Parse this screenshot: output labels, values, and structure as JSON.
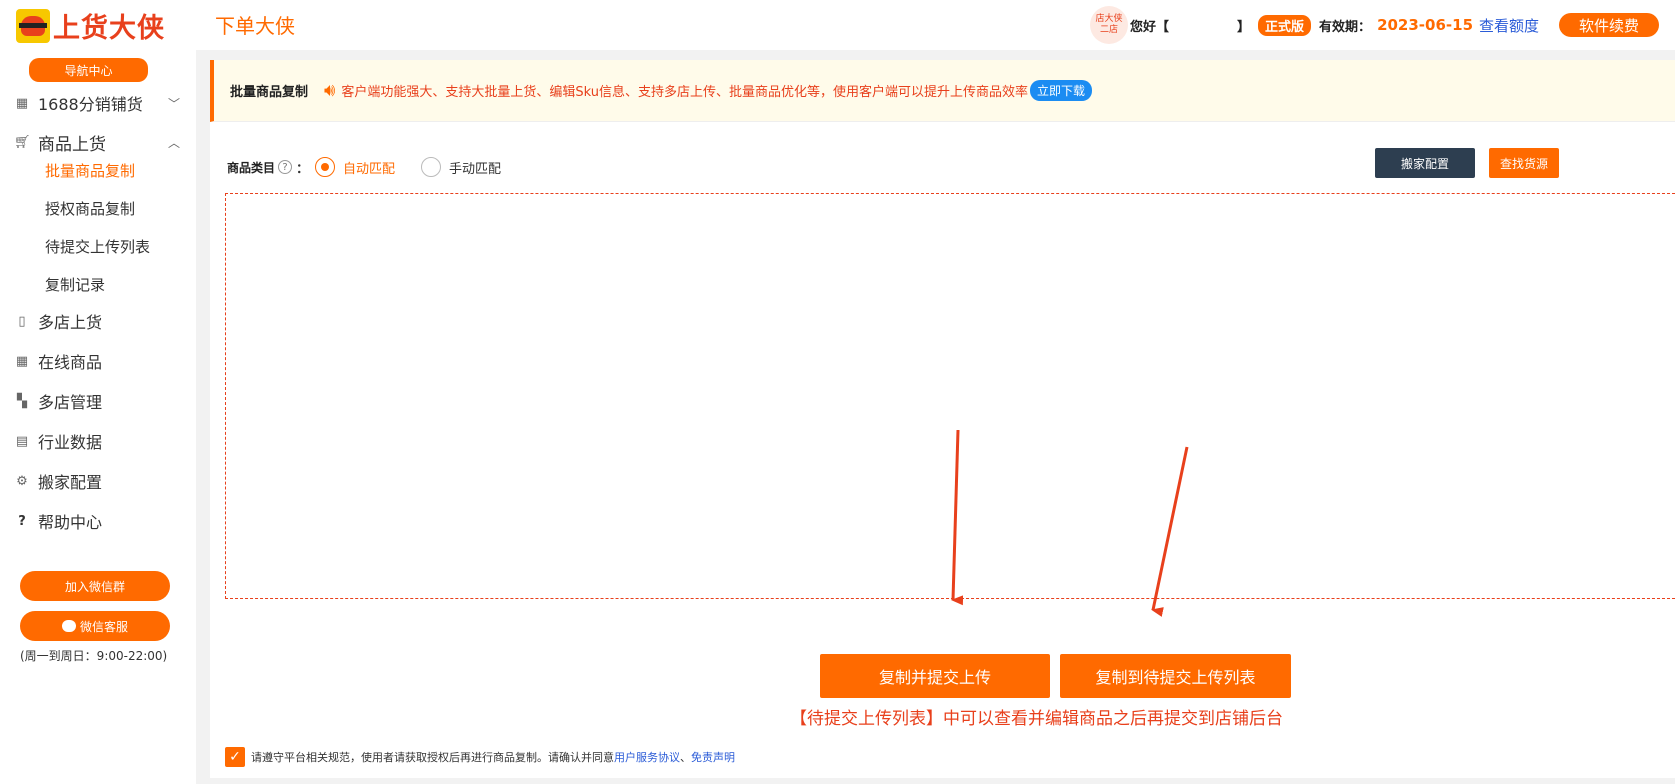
{
  "header": {
    "logo_text": "上货大侠",
    "nav_link": "下单大侠",
    "avatar_text": "店大侠 二店",
    "greeting": "您好【",
    "greeting_close": "】",
    "edition_badge": "正式版",
    "valid_label": "有效期：",
    "valid_date": "2023-06-15",
    "quota_link": "查看额度",
    "renew_button": "软件续费"
  },
  "sidebar": {
    "nav_center": "导航中心",
    "menu": [
      {
        "label": "1688分销铺货",
        "icon": "table-icon",
        "expanded": false
      },
      {
        "label": "商品上货",
        "icon": "cart-icon",
        "expanded": true
      },
      {
        "label": "多店上货",
        "icon": "file-icon"
      },
      {
        "label": "在线商品",
        "icon": "grid-icon"
      },
      {
        "label": "多店管理",
        "icon": "apps-icon"
      },
      {
        "label": "行业数据",
        "icon": "clipboard-icon"
      },
      {
        "label": "搬家配置",
        "icon": "gear-icon"
      },
      {
        "label": "帮助中心",
        "icon": "question-icon"
      }
    ],
    "submenu": [
      {
        "label": "批量商品复制",
        "active": true
      },
      {
        "label": "授权商品复制",
        "active": false
      },
      {
        "label": "待提交上传列表",
        "active": false
      },
      {
        "label": "复制记录",
        "active": false
      }
    ],
    "join_wechat_button": "加入微信群",
    "wechat_service_button": "微信客服",
    "service_hours": "(周一到周日：9:00-22:00)"
  },
  "main": {
    "title": "批量商品复制",
    "notice": "客户端功能强大、支持大批量上货、编辑Sku信息、支持多店上传、批量商品优化等，使用客户端可以提升上传商品效率",
    "download_button": "立即下载",
    "category_label": "商品类目",
    "category_colon": "：",
    "option_auto": "自动匹配",
    "option_manual": "手动匹配",
    "selected_option": "自动匹配",
    "config_button": "搬家配置",
    "find_source_button": "查找货源",
    "input_value": "",
    "copy_submit_button": "复制并提交上传",
    "copy_to_list_button": "复制到待提交上传列表",
    "hint": "【待提交上传列表】中可以查看并编辑商品之后再提交到店铺后台",
    "agree_text": "请遵守平台相关规范，使用者请获取授权后再进行商品复制。请确认并同意",
    "agreement_link": "用户服务协议",
    "separator": "、",
    "disclaimer_link": "免责声明",
    "agree_checked": true
  },
  "colors": {
    "accent": "#ff6a00",
    "alert_red": "#e8401c",
    "dark_button": "#2d3e50",
    "link_blue": "#2a5bd7"
  }
}
